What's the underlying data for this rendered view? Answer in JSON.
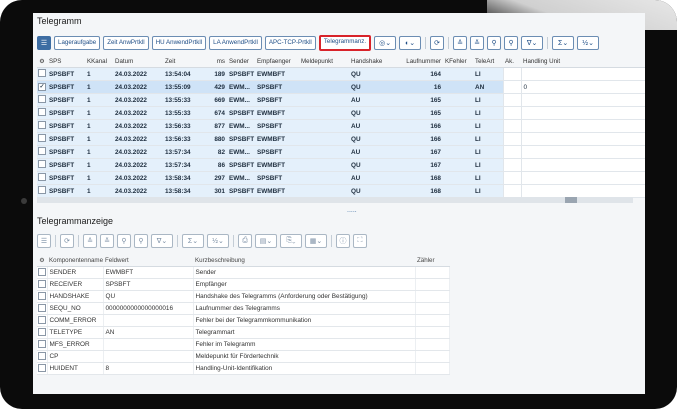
{
  "section1": {
    "title": "Telegramm",
    "buttons": [
      "Lageraufgabe",
      "Zeit AnwPrtkll",
      "HU AnwendPrtkll",
      "LA AnwendPrtkll",
      "APC-TCP-Prtkll",
      "Telegrammanz."
    ],
    "columns": [
      "SPS",
      "KKanal",
      "Datum",
      "Zeit",
      "ms",
      "Sender",
      "Empfaenger",
      "Meldepunkt",
      "Handshake",
      "Laufnummer",
      "KFehler",
      "TeleArt",
      "Ak.",
      "Handling Unit"
    ],
    "rows": [
      [
        "SPSBFT",
        "1",
        "24.03.2022",
        "13:54:04",
        "189",
        "SPSBFT",
        "EWMBFT",
        "",
        "QU",
        "164",
        "",
        "LI",
        "",
        ""
      ],
      [
        "SPSBFT",
        "1",
        "24.03.2022",
        "13:55:09",
        "429",
        "EWM...",
        "SPSBFT",
        "",
        "QU",
        "16",
        "",
        "AN",
        "",
        "0"
      ],
      [
        "SPSBFT",
        "1",
        "24.03.2022",
        "13:55:33",
        "669",
        "EWM...",
        "SPSBFT",
        "",
        "AU",
        "165",
        "",
        "LI",
        "",
        ""
      ],
      [
        "SPSBFT",
        "1",
        "24.03.2022",
        "13:55:33",
        "674",
        "SPSBFT",
        "EWMBFT",
        "",
        "QU",
        "165",
        "",
        "LI",
        "",
        ""
      ],
      [
        "SPSBFT",
        "1",
        "24.03.2022",
        "13:56:33",
        "877",
        "EWM...",
        "SPSBFT",
        "",
        "AU",
        "166",
        "",
        "LI",
        "",
        ""
      ],
      [
        "SPSBFT",
        "1",
        "24.03.2022",
        "13:56:33",
        "880",
        "SPSBFT",
        "EWMBFT",
        "",
        "QU",
        "166",
        "",
        "LI",
        "",
        ""
      ],
      [
        "SPSBFT",
        "1",
        "24.03.2022",
        "13:57:34",
        "82",
        "EWM...",
        "SPSBFT",
        "",
        "AU",
        "167",
        "",
        "LI",
        "",
        ""
      ],
      [
        "SPSBFT",
        "1",
        "24.03.2022",
        "13:57:34",
        "86",
        "SPSBFT",
        "EWMBFT",
        "",
        "QU",
        "167",
        "",
        "LI",
        "",
        ""
      ],
      [
        "SPSBFT",
        "1",
        "24.03.2022",
        "13:58:34",
        "297",
        "EWM...",
        "SPSBFT",
        "",
        "AU",
        "168",
        "",
        "LI",
        "",
        ""
      ],
      [
        "SPSBFT",
        "1",
        "24.03.2022",
        "13:58:34",
        "301",
        "SPSBFT",
        "EWMBFT",
        "",
        "QU",
        "168",
        "",
        "LI",
        "",
        ""
      ]
    ],
    "selected_row": 1,
    "more_indicator": "....."
  },
  "section2": {
    "title": "Telegrammanzeige",
    "columns": [
      "Komponentenname",
      "Feldwert",
      "Kurzbeschreibung",
      "Zähler"
    ],
    "rows": [
      [
        "SENDER",
        "EWMBFT",
        "Sender",
        ""
      ],
      [
        "RECEIVER",
        "SPSBFT",
        "Empfänger",
        ""
      ],
      [
        "HANDSHAKE",
        "QU",
        "Handshake des Telegramms (Anforderung oder Bestätigung)",
        ""
      ],
      [
        "SEQU_NO",
        "0000000000000000016",
        "Laufnummer des Telegramms",
        ""
      ],
      [
        "COMM_ERROR",
        "",
        "Fehler bei der Telegrammkommunikation",
        ""
      ],
      [
        "TELETYPE",
        "AN",
        "Telegrammart",
        ""
      ],
      [
        "MFS_ERROR",
        "",
        "Fehler im Telegramm",
        ""
      ],
      [
        "CP",
        "",
        "Meldepunkt für Fördertechnik",
        ""
      ],
      [
        "HUIDENT",
        "8",
        "Handling-Unit-Identifikation",
        ""
      ]
    ]
  },
  "colors": {
    "accent": "#3d6da3",
    "highlight": "#d8232a",
    "row_bg": "#e4f0fb"
  }
}
